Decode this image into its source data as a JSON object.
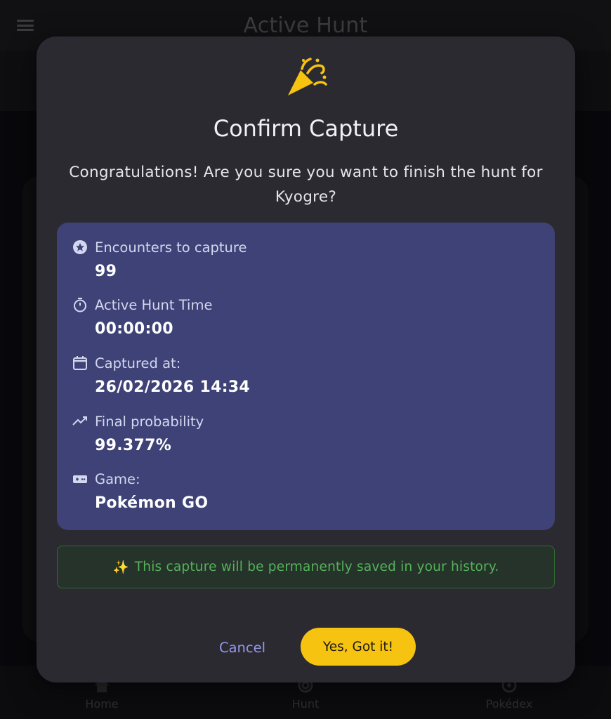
{
  "app_bar": {
    "title": "Active Hunt"
  },
  "bottom_nav": {
    "items": [
      {
        "label": "Home",
        "icon": "home-icon"
      },
      {
        "label": "Hunt",
        "icon": "target-icon"
      },
      {
        "label": "Pokédex",
        "icon": "pokeball-icon"
      }
    ]
  },
  "dialog": {
    "icon": "party-popper-icon",
    "title": "Confirm Capture",
    "message": "Congratulations! Are you sure you want to finish the hunt for Kyogre?",
    "details": [
      {
        "icon": "star-circle-icon",
        "label": "Encounters to capture",
        "value": "99"
      },
      {
        "icon": "timer-icon",
        "label": "Active Hunt Time",
        "value": "00:00:00"
      },
      {
        "icon": "calendar-icon",
        "label": "Captured at:",
        "value": "26/02/2026 14:34"
      },
      {
        "icon": "trending-up-icon",
        "label": "Final probability",
        "value": "99.377%"
      },
      {
        "icon": "gamepad-icon",
        "label": "Game:",
        "value": "Pokémon GO"
      }
    ],
    "notice": {
      "emoji": "✨",
      "text": "This capture will be permanently saved in your history."
    },
    "cancel_label": "Cancel",
    "confirm_label": "Yes, Got it!"
  },
  "colors": {
    "accent": "#f6c311",
    "panel": "#3e4277",
    "notice_text": "#55b35a",
    "link": "#9597e8"
  }
}
